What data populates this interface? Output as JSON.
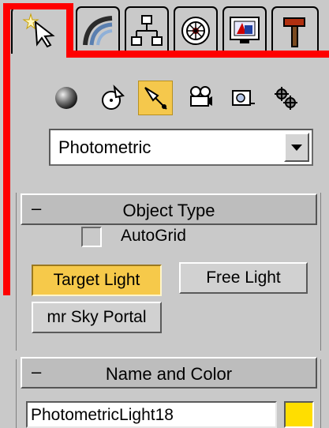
{
  "tabs": [
    {
      "icon": "create-cursor-star-icon",
      "active": true
    },
    {
      "icon": "modify-curve-icon",
      "active": false
    },
    {
      "icon": "hierarchy-icon",
      "active": false
    },
    {
      "icon": "motion-wheel-icon",
      "active": false
    },
    {
      "icon": "display-monitor-icon",
      "active": false
    },
    {
      "icon": "utilities-hammer-icon",
      "active": false
    }
  ],
  "toolbar": [
    {
      "icon": "geometry-sphere-icon",
      "active": false
    },
    {
      "icon": "shapes-icon",
      "active": false
    },
    {
      "icon": "lights-icon",
      "active": true
    },
    {
      "icon": "cameras-icon",
      "active": false
    },
    {
      "icon": "helpers-icon",
      "active": false
    },
    {
      "icon": "space-warps-icon",
      "active": false
    }
  ],
  "category_dropdown": {
    "value": "Photometric"
  },
  "object_type": {
    "minus": "–",
    "title": "Object Type",
    "autogrid_label": "AutoGrid",
    "autogrid_checked": false,
    "target_light": "Target Light",
    "free_light": "Free Light",
    "sky_portal": "mr Sky Portal"
  },
  "name_and_color": {
    "minus": "–",
    "title": "Name and Color",
    "name_value": "PhotometricLight18",
    "color": "#ffde00"
  },
  "highlight_color": "#ff0000",
  "active_button_color": "#f6c94a"
}
